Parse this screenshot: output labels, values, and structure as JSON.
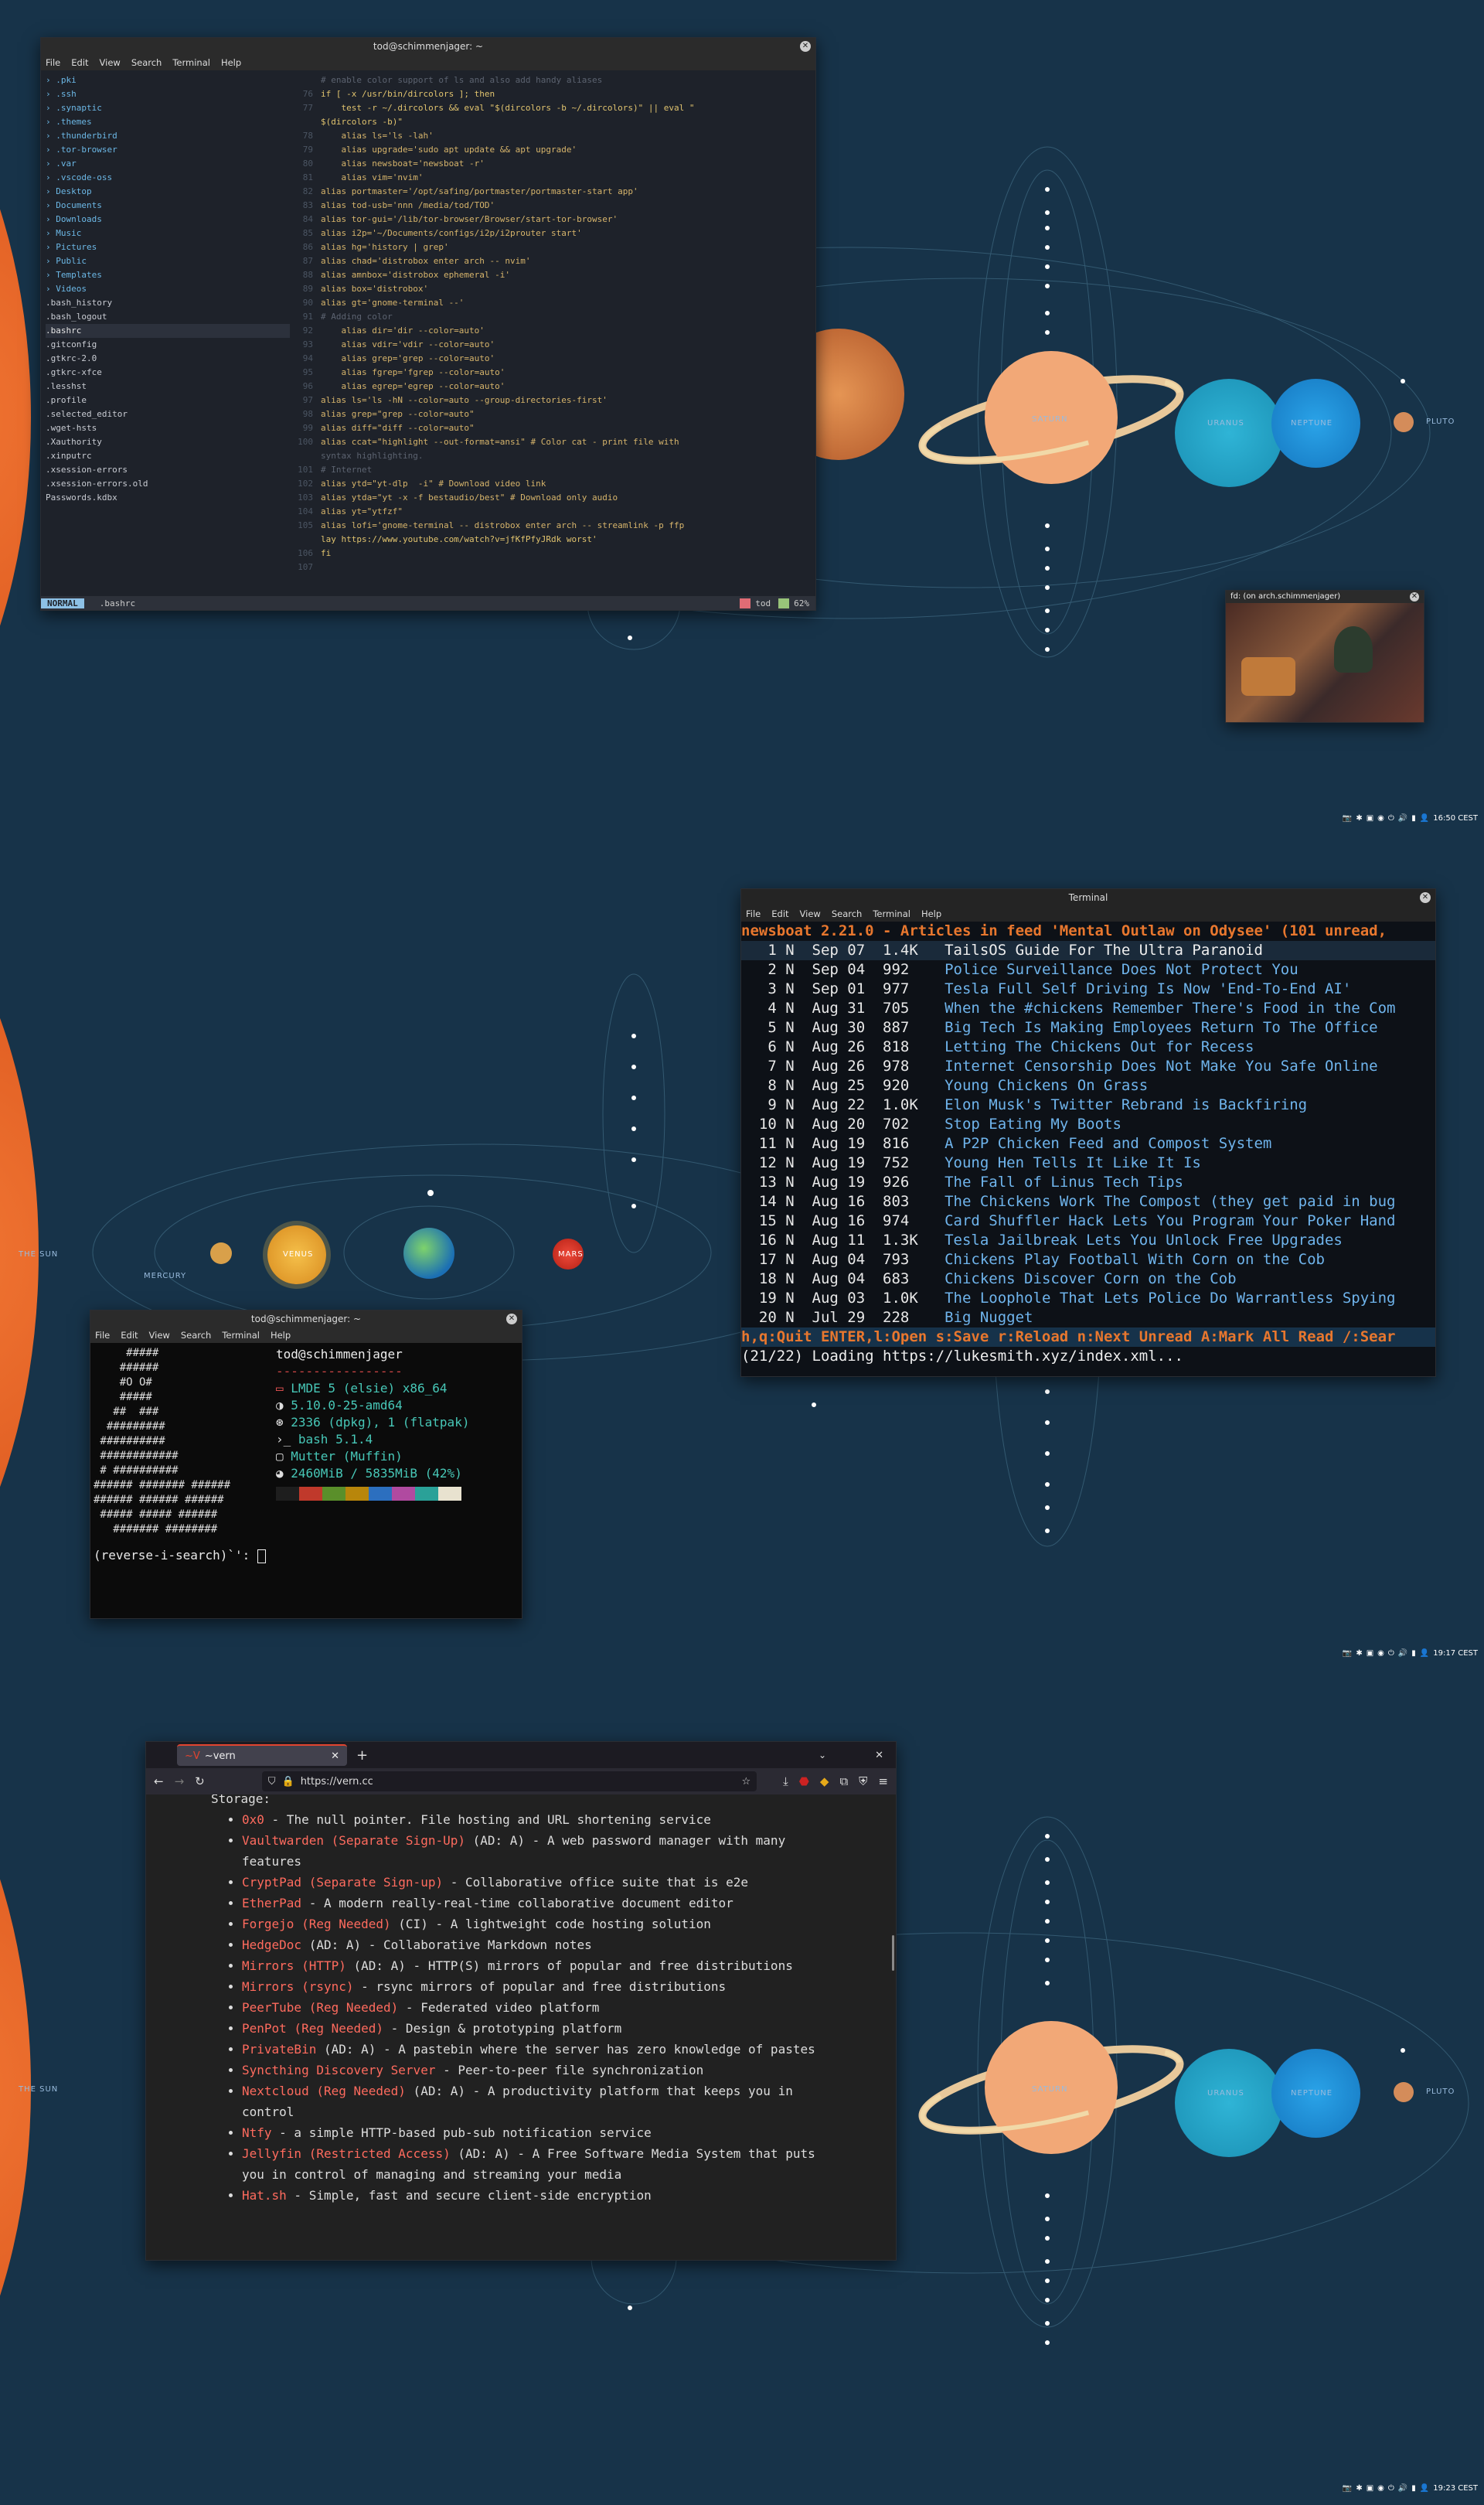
{
  "screens": [
    {
      "clock": "16:50 CEST"
    },
    {
      "clock": "19:17 CEST"
    },
    {
      "clock": "19:23 CEST"
    }
  ],
  "wall": {
    "sun": "THE SUN",
    "mercury": "MERCURY",
    "venus": "VENUS",
    "mars": "MARS",
    "saturn": "SATURN",
    "uranus": "URANUS",
    "neptune": "NEPTUNE",
    "pluto": "PLUTO",
    "colors": {
      "bg": "#173349",
      "sun": "#e2612a",
      "saturn": "#f2a877",
      "uranus": "#23a0c6",
      "neptune": "#1e8fd6"
    }
  },
  "w1": {
    "title": "tod@schimmenjager: ~",
    "menu": [
      "File",
      "Edit",
      "View",
      "Search",
      "Terminal",
      "Help"
    ],
    "tree": [
      "› .pki",
      "› .ssh",
      "› .synaptic",
      "› .themes",
      "› .thunderbird",
      "› .tor-browser",
      "› .var",
      "› .vscode-oss",
      "› Desktop",
      "› Documents",
      "› Downloads",
      "› Music",
      "› Pictures",
      "› Public",
      "› Templates",
      "› Videos",
      " .bash_history",
      " .bash_logout",
      " .bashrc",
      " .gitconfig",
      " .gtkrc-2.0",
      " .gtkrc-xfce",
      " .lesshst",
      " .profile",
      " .selected_editor",
      " .wget-hsts",
      " .Xauthority",
      " .xinputrc",
      " .xsession-errors",
      " .xsession-errors.old",
      " Passwords.kdbx"
    ],
    "lines": [
      [
        "",
        "# enable color support of ls and also add handy aliases"
      ],
      [
        "76",
        "if [ -x /usr/bin/dircolors ]; then"
      ],
      [
        "77",
        "    test -r ~/.dircolors && eval \"$(dircolors -b ~/.dircolors)\" || eval \""
      ],
      [
        "",
        "$(dircolors -b)\""
      ],
      [
        "78",
        "    alias ls='ls -lah'"
      ],
      [
        "79",
        "    alias upgrade='sudo apt update && apt upgrade'"
      ],
      [
        "80",
        "    alias newsboat='newsboat -r'"
      ],
      [
        "81",
        "    alias vim='nvim'"
      ],
      [
        "82",
        "alias portmaster='/opt/safing/portmaster/portmaster-start app'"
      ],
      [
        "83",
        "alias tod-usb='nnn /media/tod/TOD'"
      ],
      [
        "84",
        "alias tor-gui='/lib/tor-browser/Browser/start-tor-browser'"
      ],
      [
        "85",
        "alias i2p='~/Documents/configs/i2p/i2prouter start'"
      ],
      [
        "86",
        "alias hg='history | grep'"
      ],
      [
        "87",
        "alias chad='distrobox enter arch -- nvim'"
      ],
      [
        "88",
        "alias amnbox='distrobox ephemeral -i'"
      ],
      [
        "89",
        "alias box='distrobox'"
      ],
      [
        "90",
        "alias gt='gnome-terminal --'"
      ],
      [
        "91",
        "# Adding color"
      ],
      [
        "92",
        "    alias dir='dir --color=auto'"
      ],
      [
        "93",
        "    alias vdir='vdir --color=auto'"
      ],
      [
        "94",
        "    alias grep='grep --color=auto'"
      ],
      [
        "95",
        "    alias fgrep='fgrep --color=auto'"
      ],
      [
        "96",
        "    alias egrep='egrep --color=auto'"
      ],
      [
        "97",
        "alias ls='ls -hN --color=auto --group-directories-first'"
      ],
      [
        "98",
        "alias grep=\"grep --color=auto\""
      ],
      [
        "99",
        "alias diff=\"diff --color=auto\""
      ],
      [
        "100",
        "alias ccat=\"highlight --out-format=ansi\" # Color cat - print file with"
      ],
      [
        "",
        "syntax highlighting."
      ],
      [
        "101",
        "# Internet"
      ],
      [
        "102",
        "alias ytd=\"yt-dlp  -i\" # Download video link"
      ],
      [
        "103",
        "alias ytda=\"yt -x -f bestaudio/best\" # Download only audio"
      ],
      [
        "104",
        "alias yt=\"ytfzf\""
      ],
      [
        "105",
        "alias lofi='gnome-terminal -- distrobox enter arch -- streamlink -p ffp"
      ],
      [
        "",
        "lay https://www.youtube.com/watch?v=jfKfPfyJRdk worst'"
      ],
      [
        "106",
        "fi"
      ],
      [
        "107",
        ""
      ]
    ],
    "mode": "NORMAL",
    "file": ".bashrc",
    "user": "tod",
    "pct": "62%"
  },
  "pip": {
    "title": "fd: (on arch.schimmenjager)"
  },
  "nb": {
    "title": "Terminal",
    "menu": [
      "File",
      "Edit",
      "View",
      "Search",
      "Terminal",
      "Help"
    ],
    "header": "newsboat 2.21.0 - Articles in feed 'Mental Outlaw on Odysee' (101 unread,",
    "rows": [
      [
        "1",
        "N",
        "Sep 07",
        "1.4K",
        "TailsOS Guide For The Ultra Paranoid"
      ],
      [
        "2",
        "N",
        "Sep 04",
        "992",
        "Police Surveillance Does Not Protect You"
      ],
      [
        "3",
        "N",
        "Sep 01",
        "977",
        "Tesla Full Self Driving Is Now 'End-To-End AI'"
      ],
      [
        "4",
        "N",
        "Aug 31",
        "705",
        "When the #chickens Remember There's Food in the Com"
      ],
      [
        "5",
        "N",
        "Aug 30",
        "887",
        "Big Tech Is Making Employees Return To The Office"
      ],
      [
        "6",
        "N",
        "Aug 26",
        "818",
        "Letting The Chickens Out for Recess"
      ],
      [
        "7",
        "N",
        "Aug 26",
        "978",
        "Internet Censorship Does Not Make You Safe Online"
      ],
      [
        "8",
        "N",
        "Aug 25",
        "920",
        "Young Chickens On Grass"
      ],
      [
        "9",
        "N",
        "Aug 22",
        "1.0K",
        "Elon Musk's Twitter Rebrand is Backfiring"
      ],
      [
        "10",
        "N",
        "Aug 20",
        "702",
        "Stop Eating My Boots"
      ],
      [
        "11",
        "N",
        "Aug 19",
        "816",
        "A P2P Chicken Feed and Compost System"
      ],
      [
        "12",
        "N",
        "Aug 19",
        "752",
        "Young Hen Tells It Like It Is"
      ],
      [
        "13",
        "N",
        "Aug 19",
        "926",
        "The Fall of Linus Tech Tips"
      ],
      [
        "14",
        "N",
        "Aug 16",
        "803",
        "The Chickens Work The Compost (they get paid in bug"
      ],
      [
        "15",
        "N",
        "Aug 16",
        "974",
        "Card Shuffler Hack Lets You Program Your Poker Hand"
      ],
      [
        "16",
        "N",
        "Aug 11",
        "1.3K",
        "Tesla Jailbreak Lets You Unlock Free Upgrades"
      ],
      [
        "17",
        "N",
        "Aug 04",
        "793",
        "Chickens Play Football With Corn on the Cob"
      ],
      [
        "18",
        "N",
        "Aug 04",
        "683",
        "Chickens Discover Corn on the Cob"
      ],
      [
        "19",
        "N",
        "Aug 03",
        "1.0K",
        "The Loophole That Lets Police Do Warrantless Spying"
      ],
      [
        "20",
        "N",
        "Jul 29",
        "228",
        "Big Nugget"
      ]
    ],
    "keys": "h,q:Quit ENTER,l:Open s:Save r:Reload n:Next Unread A:Mark All Read /:Sear",
    "loading": "(21/22) Loading https://lukesmith.xyz/index.xml..."
  },
  "ff": {
    "title": "tod@schimmenjager: ~",
    "menu": [
      "File",
      "Edit",
      "View",
      "Search",
      "Terminal",
      "Help"
    ],
    "userhost": "tod@schimmenjager",
    "sep": "-----------------",
    "info": [
      "LMDE 5 (elsie) x86_64",
      "5.10.0-25-amd64",
      "2336 (dpkg), 1 (flatpak)",
      "bash 5.1.4",
      "Mutter (Muffin)",
      "2460MiB / 5835MiB (42%)"
    ],
    "prompt": "(reverse-i-search)`':",
    "swatches": [
      "#1e1e1e",
      "#c0392b",
      "#5a8f2a",
      "#b8860b",
      "#2c6fbf",
      "#b04aa0",
      "#2aa198",
      "#e8e2cf"
    ]
  },
  "br": {
    "tab": "~vern",
    "url": "https://vern.cc",
    "heading": "Storage:",
    "items": [
      [
        "0x0",
        "",
        " - The null pointer. File hosting and URL shortening service"
      ],
      [
        "Vaultwarden (Separate Sign-Up)",
        " (AD: A)",
        " - A web password manager with many features"
      ],
      [
        "CryptPad (Separate Sign-up)",
        "",
        " - Collaborative office suite that is e2e"
      ],
      [
        "EtherPad",
        "",
        " - A modern really-real-time collaborative document editor"
      ],
      [
        "Forgejo (Reg Needed)",
        " (CI)",
        " - A lightweight code hosting solution"
      ],
      [
        "HedgeDoc",
        " (AD: A)",
        " - Collaborative Markdown notes"
      ],
      [
        "Mirrors (HTTP)",
        " (AD: A)",
        " - HTTP(S) mirrors of popular and free distributions"
      ],
      [
        "Mirrors (rsync)",
        "",
        " - rsync mirrors of popular and free distributions"
      ],
      [
        "PeerTube (Reg Needed)",
        "",
        " - Federated video platform"
      ],
      [
        "PenPot (Reg Needed)",
        "",
        " - Design & prototyping platform"
      ],
      [
        "PrivateBin",
        " (AD: A)",
        " - A pastebin where the server has zero knowledge of pastes"
      ],
      [
        "Syncthing Discovery Server",
        "",
        " - Peer-to-peer file synchronization"
      ],
      [
        "Nextcloud (Reg Needed)",
        " (AD: A)",
        " - A productivity platform that keeps you in control"
      ],
      [
        "Ntfy",
        "",
        " - a simple HTTP-based pub-sub notification service"
      ],
      [
        "Jellyfin (Restricted Access)",
        " (AD: A)",
        " - A Free Software Media System that puts you in control of managing and streaming your media"
      ],
      [
        "Hat.sh",
        "",
        " - Simple, fast and secure client-side encryption"
      ]
    ]
  }
}
